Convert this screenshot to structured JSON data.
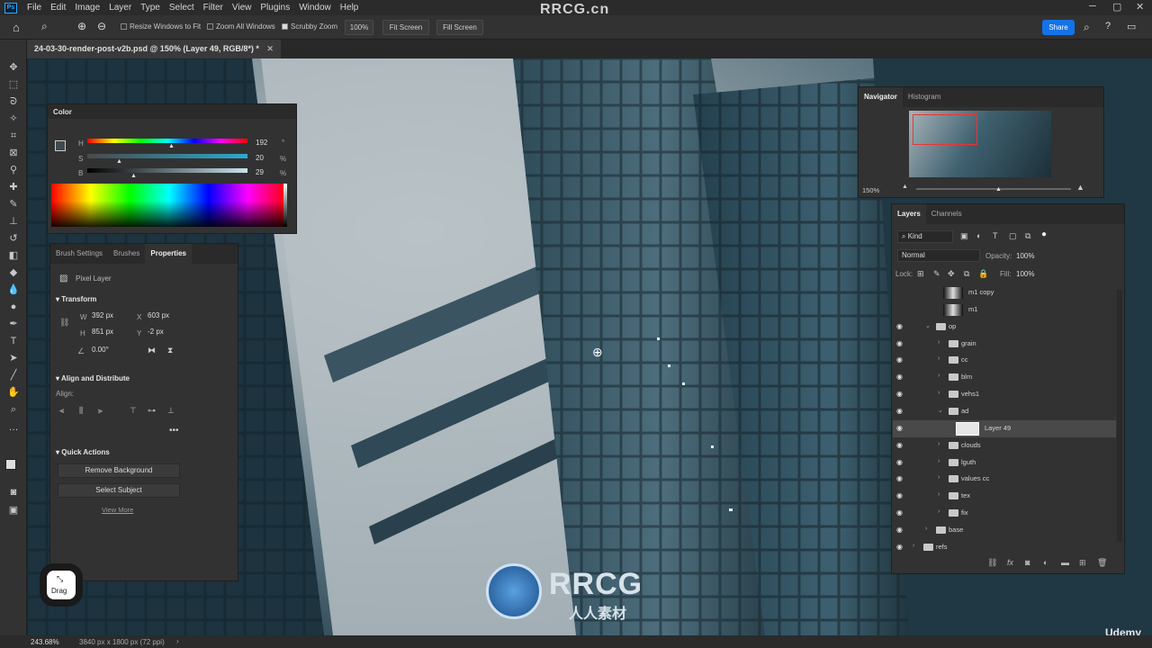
{
  "menubar": {
    "logo": "Ps",
    "items": [
      "File",
      "Edit",
      "Image",
      "Layer",
      "Type",
      "Select",
      "Filter",
      "View",
      "Plugins",
      "Window",
      "Help"
    ],
    "watermark": "RRCG.cn"
  },
  "options": {
    "resize_windows": "Resize Windows to Fit",
    "zoom_all": "Zoom All Windows",
    "scrubby": "Scrubby Zoom",
    "zoom_value": "100%",
    "fit_screen": "Fit Screen",
    "fill_screen": "Fill Screen",
    "share": "Share"
  },
  "document": {
    "tab_title": "24-03-30-render-post-v2b.psd @ 150% (Layer 49, RGB/8*) *"
  },
  "color_panel": {
    "title": "Color",
    "h_label": "H",
    "h_value": "192",
    "h_unit": "°",
    "s_label": "S",
    "s_value": "20",
    "s_unit": "%",
    "b_label": "B",
    "b_value": "29",
    "b_unit": "%"
  },
  "properties_panel": {
    "tabs": [
      "Brush Settings",
      "Brushes",
      "Properties"
    ],
    "layer_type": "Pixel Layer",
    "transform_title": "Transform",
    "w_label": "W",
    "w_value": "392 px",
    "x_label": "X",
    "x_value": "603 px",
    "h_label": "H",
    "h_value": "851 px",
    "y_label": "Y",
    "y_value": "-2 px",
    "angle_value": "0.00°",
    "align_title": "Align and Distribute",
    "align_label": "Align:",
    "quick_title": "Quick Actions",
    "remove_bg": "Remove Background",
    "select_subject": "Select Subject",
    "view_more": "View More"
  },
  "navigator": {
    "tabs": [
      "Navigator",
      "Histogram"
    ],
    "zoom": "150%"
  },
  "layers_panel": {
    "tabs": [
      "Layers",
      "Channels"
    ],
    "kind": "Kind",
    "blend": "Normal",
    "opacity_label": "Opacity:",
    "opacity_value": "100%",
    "lock_label": "Lock:",
    "fill_label": "Fill:",
    "fill_value": "100%",
    "layers": [
      {
        "name": "m1 copy",
        "type": "mask",
        "indent": 1,
        "visible": false
      },
      {
        "name": "m1",
        "type": "mask",
        "indent": 1,
        "visible": false
      },
      {
        "name": "op",
        "type": "folder-open",
        "indent": 1,
        "visible": true
      },
      {
        "name": "grain",
        "type": "folder",
        "indent": 2,
        "visible": true
      },
      {
        "name": "cc",
        "type": "folder",
        "indent": 2,
        "visible": true
      },
      {
        "name": "blm",
        "type": "folder",
        "indent": 2,
        "visible": true
      },
      {
        "name": "vehs1",
        "type": "folder",
        "indent": 2,
        "visible": true
      },
      {
        "name": "ad",
        "type": "folder-open",
        "indent": 2,
        "visible": true
      },
      {
        "name": "Layer 49",
        "type": "pixel",
        "indent": 3,
        "visible": true,
        "selected": true
      },
      {
        "name": "clouds",
        "type": "folder",
        "indent": 2,
        "visible": true
      },
      {
        "name": "lguth",
        "type": "folder",
        "indent": 2,
        "visible": true
      },
      {
        "name": "values cc",
        "type": "folder",
        "indent": 2,
        "visible": true
      },
      {
        "name": "tex",
        "type": "folder",
        "indent": 2,
        "visible": true
      },
      {
        "name": "fix",
        "type": "folder",
        "indent": 2,
        "visible": true
      },
      {
        "name": "base",
        "type": "folder",
        "indent": 1,
        "visible": true
      },
      {
        "name": "refs",
        "type": "folder",
        "indent": 0,
        "visible": true
      }
    ]
  },
  "drag_widget": {
    "label": "Drag"
  },
  "status": {
    "zoom": "243.68%",
    "doc_size": "3840 px x 1800 px (72 ppi)"
  },
  "watermark": {
    "brand": "RRCG",
    "sub": "人人素材",
    "udemy": "Udemy"
  },
  "colors": {
    "accent": "#1473e6",
    "panel_bg": "#323232",
    "selection_bg": "#494949"
  }
}
